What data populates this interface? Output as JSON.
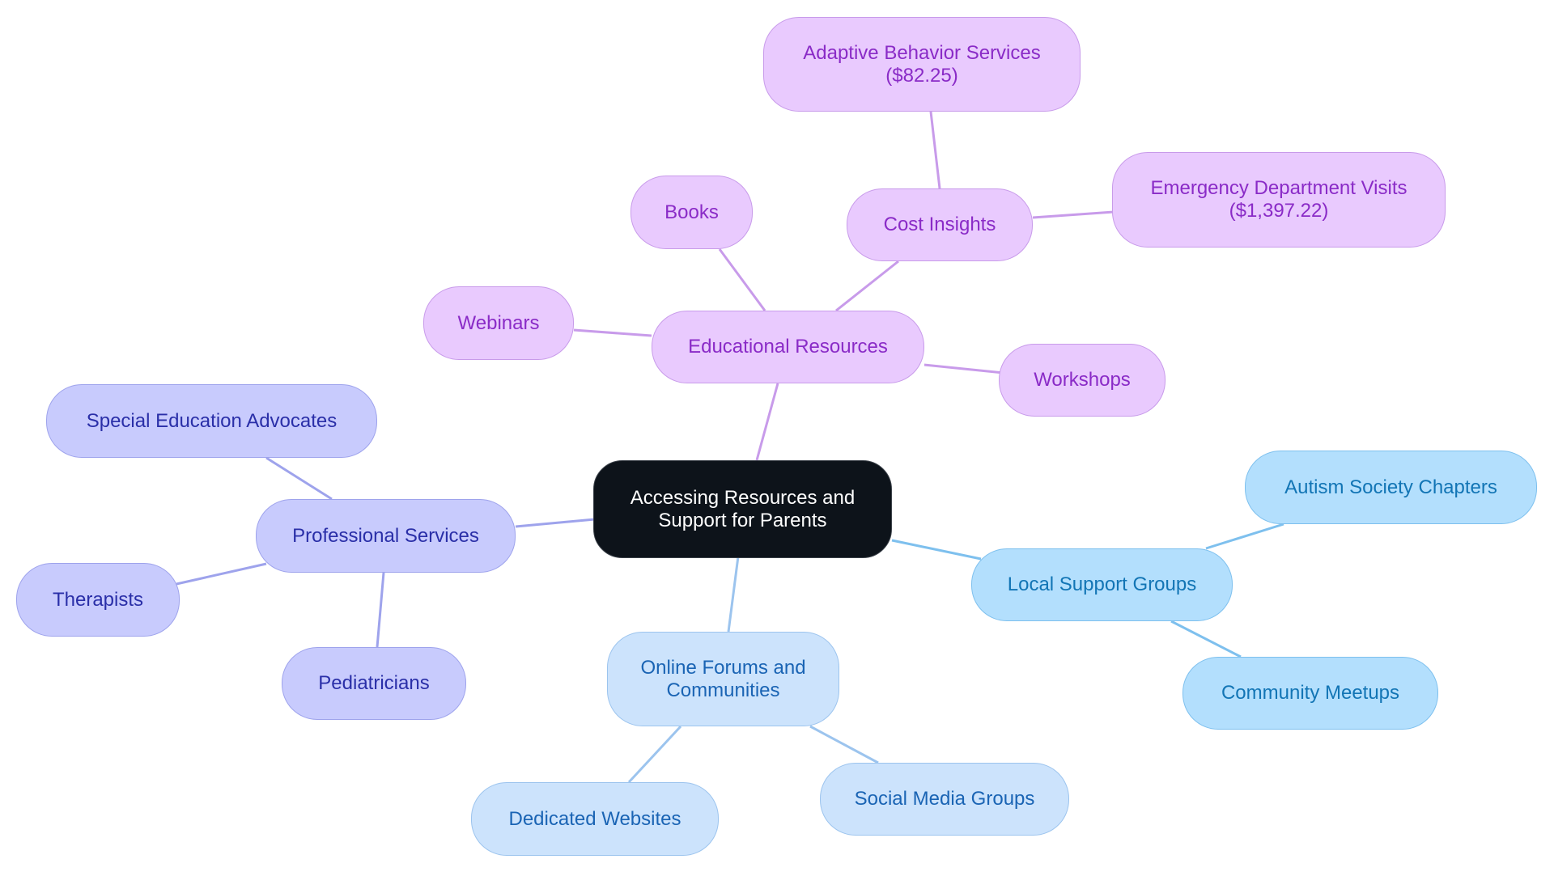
{
  "diagram": {
    "type": "mind-map",
    "colors": {
      "root_fill": "#0D131A",
      "educational_branch": "#E9CAFE",
      "professional_branch": "#C8CBFD",
      "online_branch": "#CCE3FC",
      "local_branch": "#B3DFFD",
      "edge_purple": "#C89BEA",
      "edge_peri": "#9EA3EC",
      "edge_lblue": "#9CC4EE",
      "edge_sky": "#7EC0EE"
    },
    "root": {
      "id": "root",
      "label": "Accessing Resources and\nSupport for Parents"
    },
    "nodes": [
      {
        "id": "edu",
        "label": "Educational Resources",
        "parent": "root"
      },
      {
        "id": "books",
        "label": "Books",
        "parent": "edu"
      },
      {
        "id": "webinars",
        "label": "Webinars",
        "parent": "edu"
      },
      {
        "id": "workshops",
        "label": "Workshops",
        "parent": "edu"
      },
      {
        "id": "cost",
        "label": "Cost Insights",
        "parent": "edu"
      },
      {
        "id": "abs",
        "label": "Adaptive Behavior Services\n($82.25)",
        "parent": "cost"
      },
      {
        "id": "edv",
        "label": "Emergency Department Visits\n($1,397.22)",
        "parent": "cost"
      },
      {
        "id": "prof",
        "label": "Professional Services",
        "parent": "root"
      },
      {
        "id": "sea",
        "label": "Special Education Advocates",
        "parent": "prof"
      },
      {
        "id": "ther",
        "label": "Therapists",
        "parent": "prof"
      },
      {
        "id": "ped",
        "label": "Pediatricians",
        "parent": "prof"
      },
      {
        "id": "online",
        "label": "Online Forums and\nCommunities",
        "parent": "root"
      },
      {
        "id": "web",
        "label": "Dedicated Websites",
        "parent": "online"
      },
      {
        "id": "social",
        "label": "Social Media Groups",
        "parent": "online"
      },
      {
        "id": "local",
        "label": "Local Support Groups",
        "parent": "root"
      },
      {
        "id": "autism",
        "label": "Autism Society Chapters",
        "parent": "local"
      },
      {
        "id": "meetups",
        "label": "Community Meetups",
        "parent": "local"
      }
    ]
  }
}
